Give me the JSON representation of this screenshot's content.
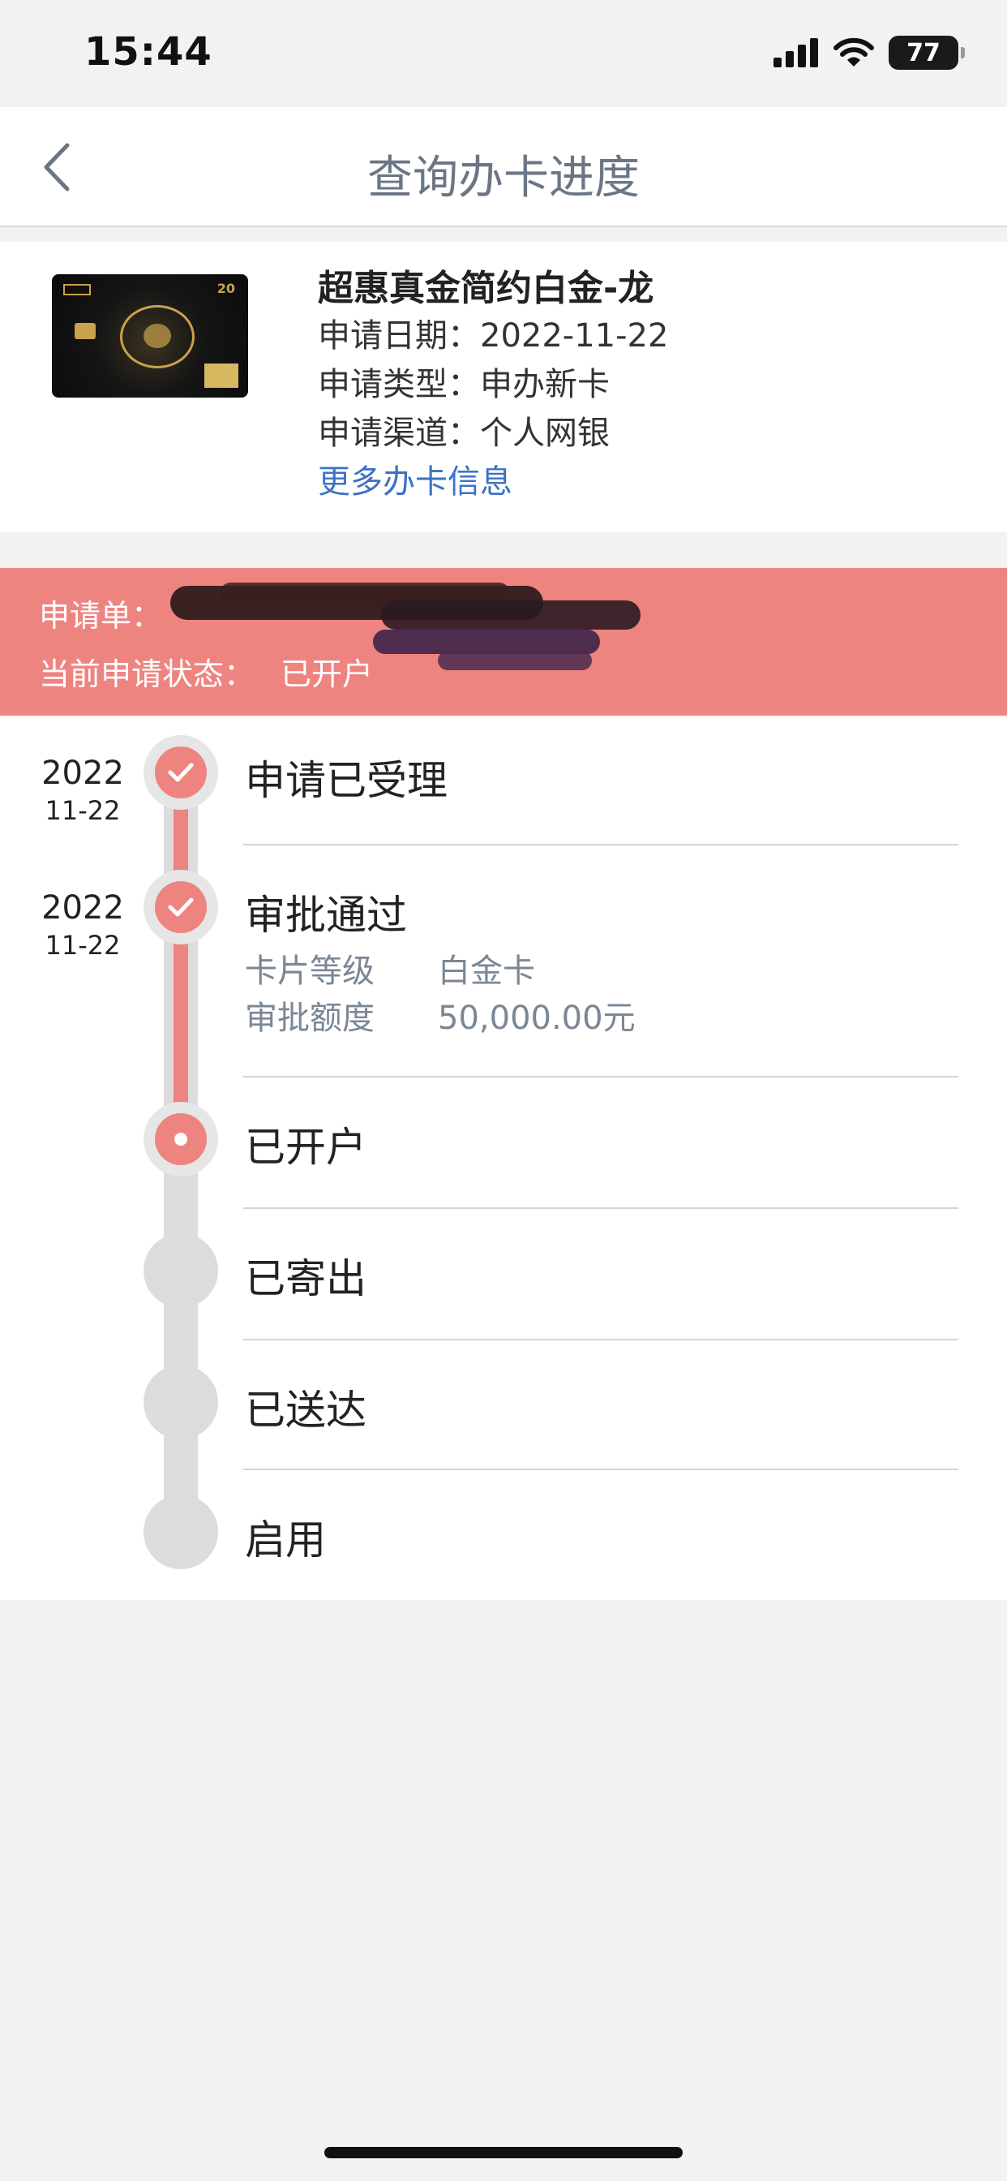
{
  "status_bar": {
    "time": "15:44",
    "battery": "77"
  },
  "nav": {
    "title": "查询办卡进度"
  },
  "card": {
    "name": "超惠真金简约白金-龙",
    "apply_date": "申请日期：2022-11-22",
    "apply_type": "申请类型：申办新卡",
    "apply_channel": "申请渠道：个人网银",
    "more_link": "更多办卡信息",
    "image_text": "20"
  },
  "banner": {
    "order_label": "申请单：",
    "status_label": "当前申请状态：",
    "status_value": "已开户"
  },
  "timeline": {
    "steps": [
      {
        "title": "申请已受理",
        "year": "2022",
        "date": "11-22",
        "state": "done"
      },
      {
        "title": "审批通过",
        "year": "2022",
        "date": "11-22",
        "state": "done",
        "details": [
          {
            "label": "卡片等级",
            "value": "白金卡"
          },
          {
            "label": "审批额度",
            "value": "50,000.00元"
          }
        ]
      },
      {
        "title": "已开户",
        "state": "current"
      },
      {
        "title": "已寄出",
        "state": "pending"
      },
      {
        "title": "已送达",
        "state": "pending"
      },
      {
        "title": "启用",
        "state": "pending"
      }
    ]
  },
  "colors": {
    "accent": "#ee8480",
    "link": "#3d72c5",
    "nav_title": "#6b7685",
    "detail_text": "#7a8795"
  }
}
